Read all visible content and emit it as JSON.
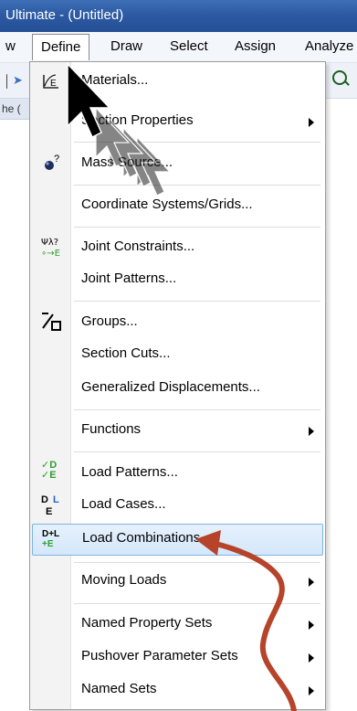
{
  "window": {
    "title": "Ultimate  - (Untitled)"
  },
  "menubar": {
    "items": [
      {
        "label": "w"
      },
      {
        "label": "Define"
      },
      {
        "label": "Draw"
      },
      {
        "label": "Select"
      },
      {
        "label": "Assign"
      },
      {
        "label": "Analyze"
      }
    ]
  },
  "workspace": {
    "label": "he ("
  },
  "define_menu": {
    "items": [
      {
        "label": "Materials...",
        "icon": "materials-icon"
      },
      {
        "label": "Section Properties",
        "icon": "",
        "submenu": true
      },
      {
        "label": "Mass Source...",
        "icon": "mass-source-icon"
      },
      {
        "label": "Coordinate Systems/Grids...",
        "icon": ""
      },
      {
        "label": "Joint Constraints...",
        "icon": "joint-constraints-icon"
      },
      {
        "label": "Joint Patterns...",
        "icon": ""
      },
      {
        "label": "Groups...",
        "icon": "groups-icon"
      },
      {
        "label": "Section Cuts...",
        "icon": ""
      },
      {
        "label": "Generalized Displacements...",
        "icon": ""
      },
      {
        "label": "Functions",
        "icon": "",
        "submenu": true
      },
      {
        "label": "Load Patterns...",
        "icon": "load-patterns-icon"
      },
      {
        "label": "Load Cases...",
        "icon": "load-cases-icon"
      },
      {
        "label": "Load Combinations...",
        "icon": "load-combinations-icon",
        "highlighted": true
      },
      {
        "label": "Moving Loads",
        "icon": "",
        "submenu": true
      },
      {
        "label": "Named Property Sets",
        "icon": "",
        "submenu": true
      },
      {
        "label": "Pushover Parameter Sets",
        "icon": "",
        "submenu": true
      },
      {
        "label": "Named Sets",
        "icon": "",
        "submenu": true
      }
    ]
  },
  "icon_text": {
    "materials": "E",
    "mass": "?",
    "joint_top": "Ψλ?",
    "joint_bot": "∘→E",
    "lp_top": "✓D",
    "lp_bot": "✓E",
    "lc_d": "D",
    "lc_l": "L",
    "lc_e": "E",
    "comb_top": "D+L",
    "comb_bot": "+E"
  },
  "colors": {
    "title_bar": "#2c5aa3",
    "highlight": "#d4e7fb",
    "highlight_border": "#7fb4e6",
    "annotation_arrow": "#b5442b",
    "cursor": "#000000"
  }
}
